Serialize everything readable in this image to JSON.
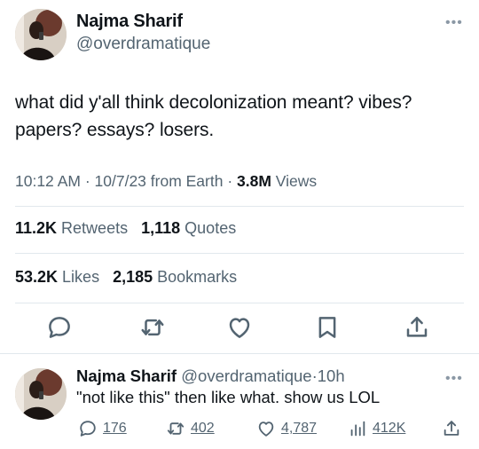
{
  "colors": {
    "text": "#0f1419",
    "secondary": "#536471",
    "icon": "#536471",
    "divider": "#e1e8ed",
    "avatar_bg": "#d8cfc4"
  },
  "main_tweet": {
    "author": {
      "name": "Najma Sharif",
      "handle": "@overdramatique"
    },
    "more_icon": "more-horizontal-icon",
    "text_line_1": "what did y'all think decolonization meant? vibes?",
    "text_line_2": "papers? essays? losers.",
    "meta": {
      "time": "10:12 AM",
      "sep1": " · ",
      "date": "10/7/23",
      "from": " from Earth",
      "sep2": " · ",
      "views": "3.8M",
      "views_label": " Views"
    },
    "stats_row_1": {
      "retweets": "11.2K",
      "retweets_label": " Retweets",
      "quotes": "1,118",
      "quotes_label": " Quotes"
    },
    "stats_row_2": {
      "likes": "53.2K",
      "likes_label": " Likes",
      "bookmarks": "2,185",
      "bookmarks_label": " Bookmarks"
    },
    "actions": [
      "reply-icon",
      "retweet-icon",
      "like-icon",
      "bookmark-icon",
      "share-icon"
    ]
  },
  "reply": {
    "name": "Najma Sharif",
    "handle": " @overdramatique",
    "dot": "·",
    "time": "10h",
    "text": "\"not like this\" then like what. show us LOL",
    "counts": {
      "replies": "176",
      "retweets": "402",
      "likes": "4,787",
      "views": "412K"
    }
  }
}
